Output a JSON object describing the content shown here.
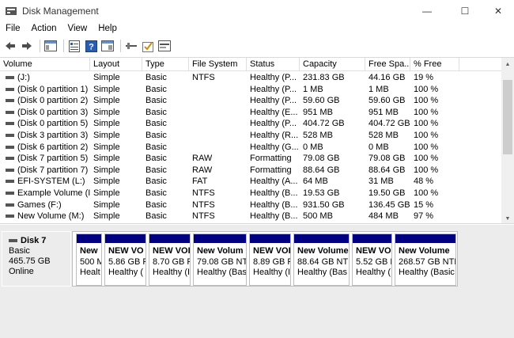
{
  "window": {
    "title": "Disk Management",
    "minimize_glyph": "—",
    "maximize_glyph": "☐",
    "close_glyph": "✕"
  },
  "menu": [
    "File",
    "Action",
    "View",
    "Help"
  ],
  "toolbar": {
    "icons": [
      "back-arrow-icon",
      "forward-arrow-icon",
      "console-tree-icon",
      "properties-icon",
      "help-icon",
      "connect-icon",
      "check-icon",
      "disk-view-icon"
    ]
  },
  "volume_list": {
    "columns": [
      "Volume",
      "Layout",
      "Type",
      "File System",
      "Status",
      "Capacity",
      "Free Spa...",
      "% Free"
    ],
    "rows": [
      [
        "(J:)",
        "Simple",
        "Basic",
        "NTFS",
        "Healthy (P...",
        "231.83 GB",
        "44.16 GB",
        "19 %"
      ],
      [
        "(Disk 0 partition 1)",
        "Simple",
        "Basic",
        "",
        "Healthy (P...",
        "1 MB",
        "1 MB",
        "100 %"
      ],
      [
        "(Disk 0 partition 2)",
        "Simple",
        "Basic",
        "",
        "Healthy (P...",
        "59.60 GB",
        "59.60 GB",
        "100 %"
      ],
      [
        "(Disk 0 partition 3)",
        "Simple",
        "Basic",
        "",
        "Healthy (E...",
        "951 MB",
        "951 MB",
        "100 %"
      ],
      [
        "(Disk 0 partition 5)",
        "Simple",
        "Basic",
        "",
        "Healthy (P...",
        "404.72 GB",
        "404.72 GB",
        "100 %"
      ],
      [
        "(Disk 3 partition 3)",
        "Simple",
        "Basic",
        "",
        "Healthy (R...",
        "528 MB",
        "528 MB",
        "100 %"
      ],
      [
        "(Disk 6 partition 2)",
        "Simple",
        "Basic",
        "",
        "Healthy (G...",
        "0 MB",
        "0 MB",
        "100 %"
      ],
      [
        "(Disk 7 partition 5)",
        "Simple",
        "Basic",
        "RAW",
        "Formatting",
        "79.08 GB",
        "79.08 GB",
        "100 %"
      ],
      [
        "(Disk 7 partition 7)",
        "Simple",
        "Basic",
        "RAW",
        "Formatting",
        "88.64 GB",
        "88.64 GB",
        "100 %"
      ],
      [
        "EFI-SYSTEM (L:)",
        "Simple",
        "Basic",
        "FAT",
        "Healthy (A...",
        "64 MB",
        "31 MB",
        "48 %"
      ],
      [
        "Example Volume (I:)",
        "Simple",
        "Basic",
        "NTFS",
        "Healthy (B...",
        "19.53 GB",
        "19.50 GB",
        "100 %"
      ],
      [
        "Games (F:)",
        "Simple",
        "Basic",
        "NTFS",
        "Healthy (B...",
        "931.50 GB",
        "136.45 GB",
        "15 %"
      ],
      [
        "New Volume (M:)",
        "Simple",
        "Basic",
        "NTFS",
        "Healthy (B...",
        "500 MB",
        "484 MB",
        "97 %"
      ]
    ],
    "scroll_up_glyph": "▲",
    "scroll_down_glyph": "▼"
  },
  "disk": {
    "name": "Disk 7",
    "type": "Basic",
    "size": "465.75 GB",
    "status": "Online",
    "partitions": [
      {
        "name": "New",
        "size": "500 M",
        "status": "Healt"
      },
      {
        "name": "NEW VO",
        "size": "5.86 GB F",
        "status": "Healthy ("
      },
      {
        "name": "NEW VOI",
        "size": "8.70 GB F",
        "status": "Healthy (I"
      },
      {
        "name": "New Volum",
        "size": "79.08 GB NTF",
        "status": "Healthy (Bas"
      },
      {
        "name": "NEW VOI",
        "size": "8.89 GB F",
        "status": "Healthy (I"
      },
      {
        "name": "New Volume",
        "size": "88.64 GB NTF",
        "status": "Healthy (Bas"
      },
      {
        "name": "NEW VO",
        "size": "5.52 GB F",
        "status": "Healthy ("
      },
      {
        "name": "New Volume",
        "size": "268.57 GB NTFS",
        "status": "Healthy (Basic I"
      }
    ]
  },
  "colors": {
    "partition_bar": "#000080",
    "graphical_bg": "#ececec"
  }
}
